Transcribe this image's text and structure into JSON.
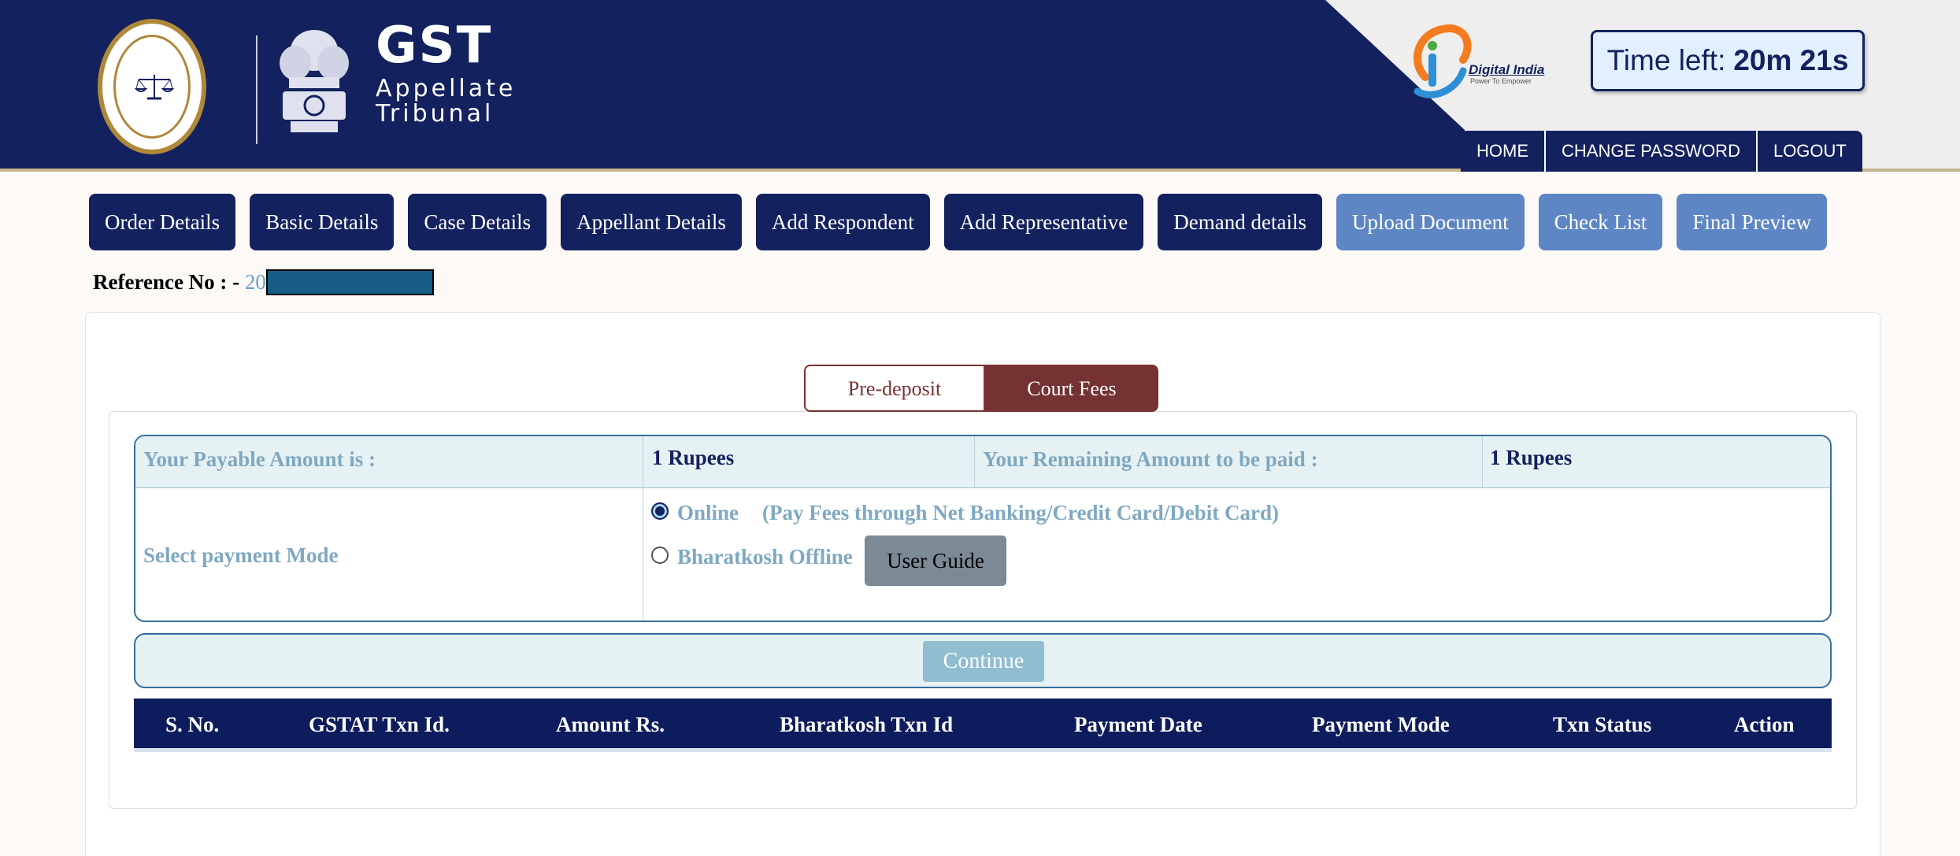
{
  "header": {
    "title": "GST",
    "subtitle_line1": "Appellate",
    "subtitle_line2": "Tribunal",
    "digital_india_title": "Digital India",
    "digital_india_sub": "Power To Empower",
    "timer_label": "Time left:",
    "timer_value": "20m 21s",
    "nav": [
      "HOME",
      "CHANGE PASSWORD",
      "LOGOUT"
    ]
  },
  "steps": [
    {
      "label": "Order Details"
    },
    {
      "label": "Basic Details"
    },
    {
      "label": "Case Details"
    },
    {
      "label": "Appellant Details"
    },
    {
      "label": "Add Respondent"
    },
    {
      "label": "Add Representative"
    },
    {
      "label": "Demand details"
    },
    {
      "label": "Upload Document"
    },
    {
      "label": "Check List"
    },
    {
      "label": "Final Preview"
    }
  ],
  "reference": {
    "label": "Reference No : -",
    "value": "20"
  },
  "fee_tabs": {
    "pre_deposit": "Pre-deposit",
    "court_fees": "Court Fees",
    "active": "Court Fees"
  },
  "payment": {
    "payable_label": "Your Payable Amount is :",
    "payable_value": "1 Rupees",
    "remaining_label": "Your Remaining Amount to be paid :",
    "remaining_value": "1 Rupees",
    "mode_label": "Select payment Mode",
    "online_label": "Online",
    "online_desc": "(Pay Fees through Net Banking/Credit Card/Debit Card)",
    "offline_label": "Bharatkosh Offline",
    "selected_mode": "Online",
    "user_guide": "User Guide",
    "continue": "Continue"
  },
  "txn_table": {
    "columns": [
      "S. No.",
      "GSTAT Txn Id.",
      "Amount Rs.",
      "Bharatkosh Txn Id",
      "Payment Date",
      "Payment Mode",
      "Txn Status",
      "Action"
    ],
    "rows": []
  },
  "colors": {
    "navy": "#13215e",
    "light_step": "#5e86c4",
    "court_fees_active": "#743232"
  }
}
